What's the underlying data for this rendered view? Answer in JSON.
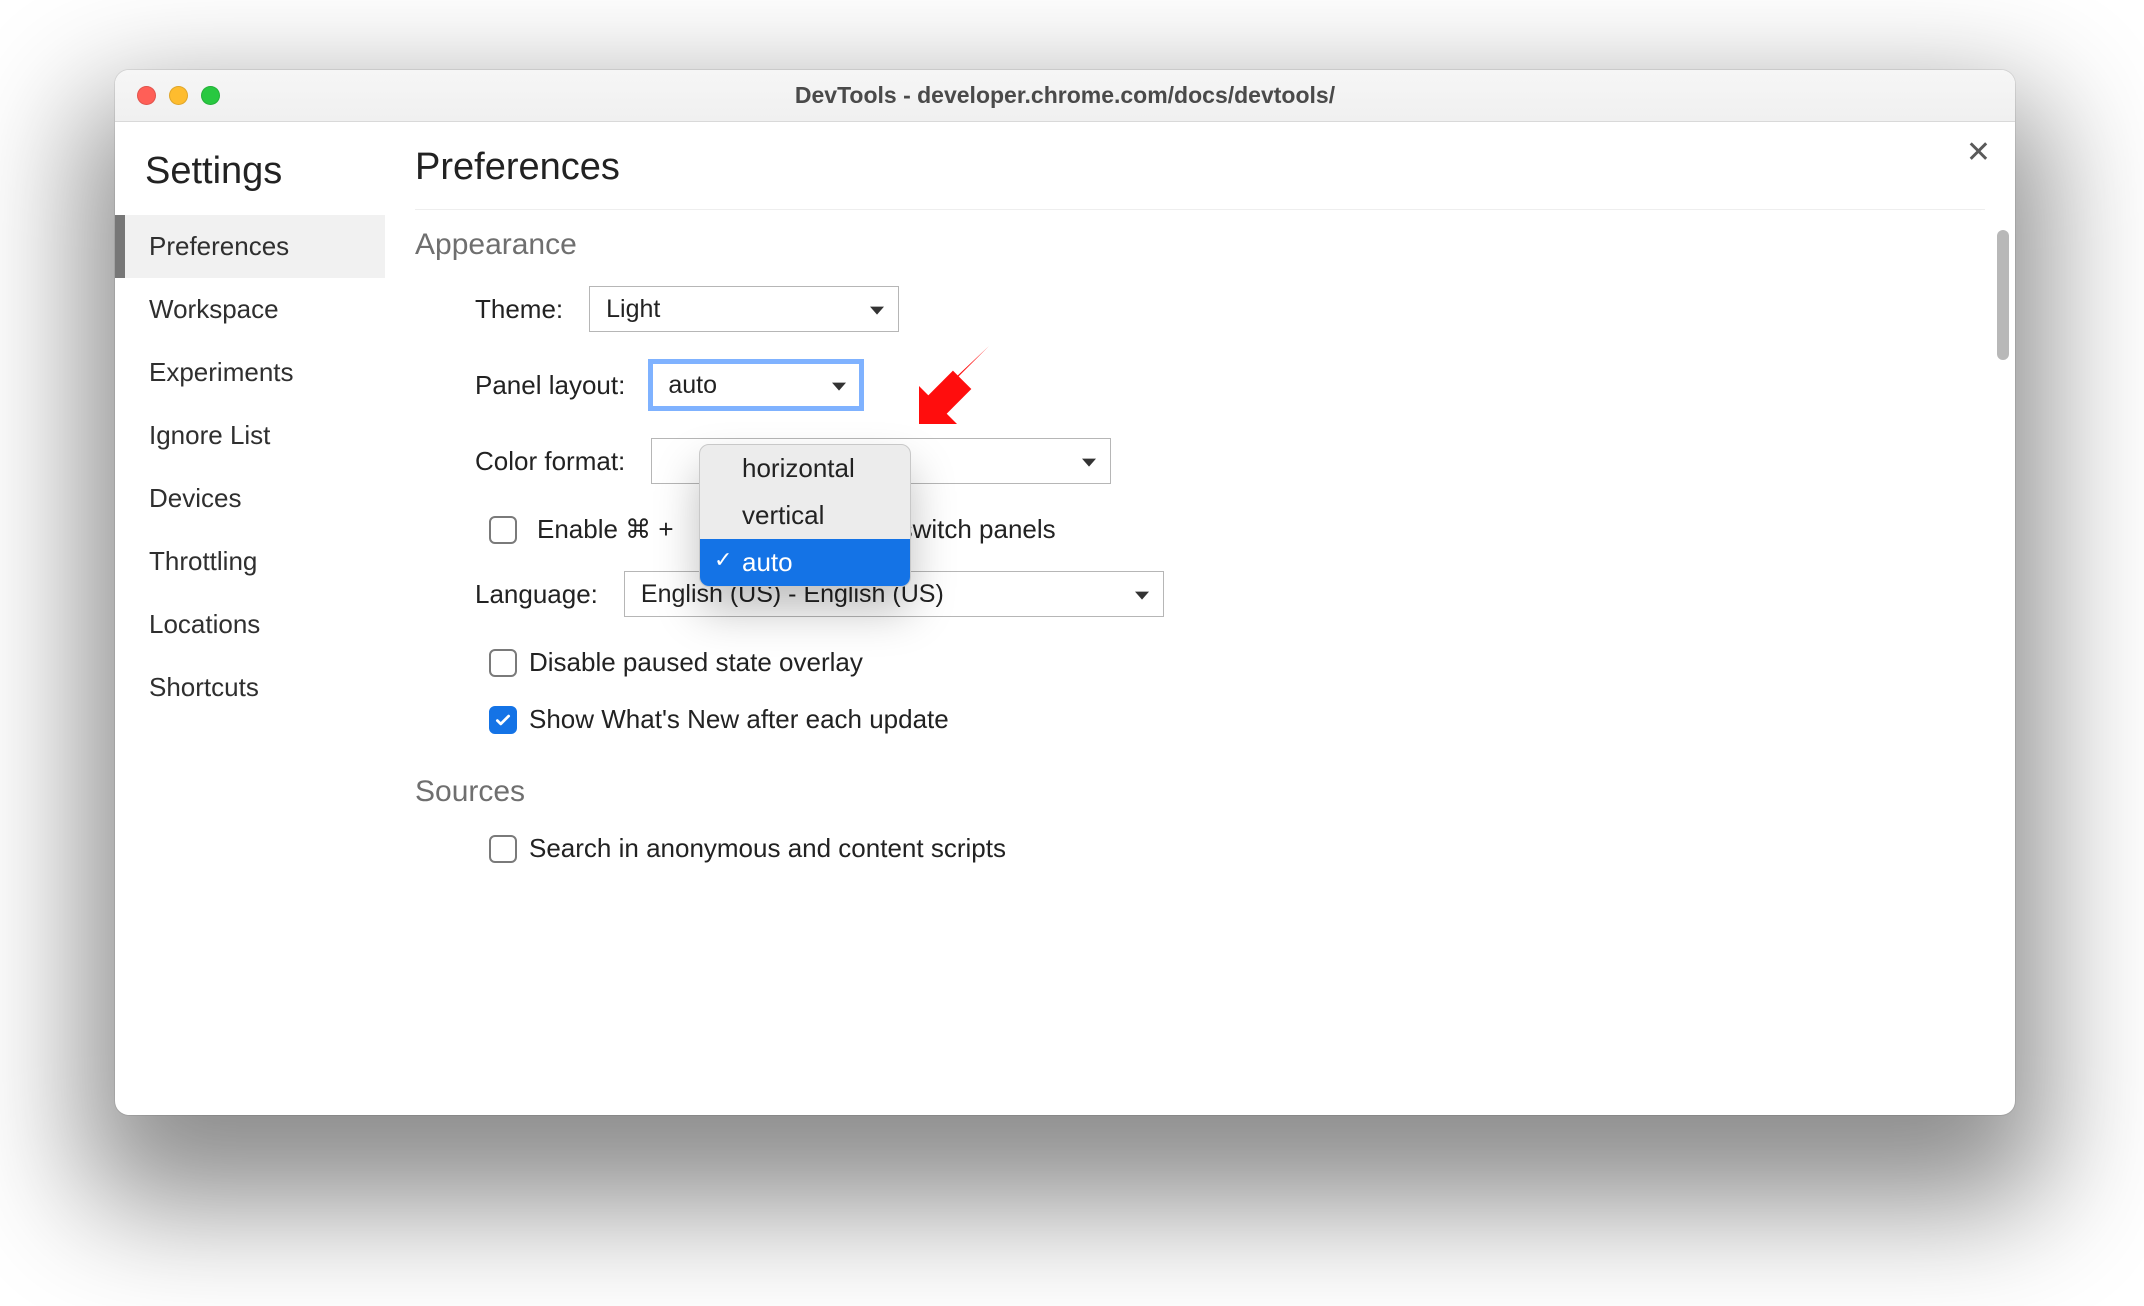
{
  "window": {
    "title": "DevTools - developer.chrome.com/docs/devtools/"
  },
  "sidebar": {
    "heading": "Settings",
    "items": [
      "Preferences",
      "Workspace",
      "Experiments",
      "Ignore List",
      "Devices",
      "Throttling",
      "Locations",
      "Shortcuts"
    ],
    "active_index": 0
  },
  "page": {
    "title": "Preferences",
    "sections": {
      "appearance": {
        "heading": "Appearance",
        "theme_label": "Theme:",
        "theme_value": "Light",
        "panel_layout_label": "Panel layout:",
        "panel_layout_value": "auto",
        "panel_layout_options": [
          "horizontal",
          "vertical",
          "auto"
        ],
        "panel_layout_selected_index": 2,
        "color_format_label": "Color format:",
        "enable_shortcut_prefix": "Enable ⌘ +",
        "enable_shortcut_suffix": " switch panels",
        "language_label": "Language:",
        "language_value": "English (US) - English (US)",
        "disable_paused_label": "Disable paused state overlay",
        "disable_paused_checked": false,
        "show_whats_new_label": "Show What's New after each update",
        "show_whats_new_checked": true
      },
      "sources": {
        "heading": "Sources",
        "search_anon_label": "Search in anonymous and content scripts",
        "search_anon_checked": false
      }
    }
  },
  "annotation": {
    "type": "arrow",
    "color": "#ff0000"
  }
}
